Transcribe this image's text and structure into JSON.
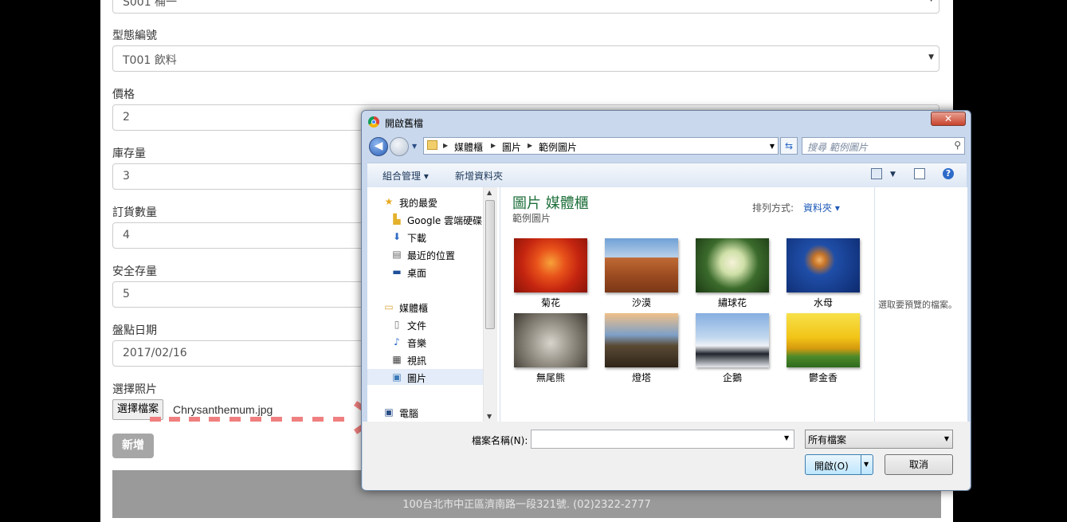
{
  "form": {
    "top_select_value": "S001 桶一",
    "type_label": "型態編號",
    "type_value": "T001 飲料",
    "price_label": "價格",
    "price_value": "2",
    "stock_label": "庫存量",
    "stock_value": "3",
    "order_label": "訂貨數量",
    "order_value": "4",
    "safety_label": "安全存量",
    "safety_value": "5",
    "date_label": "盤點日期",
    "date_value": "2017/02/16",
    "photo_label": "選擇照片",
    "file_button": "選擇檔案",
    "file_name": "Chrysanthemum.jpg",
    "add_button": "新增"
  },
  "footer": {
    "address": "100台北市中正區濟南路一段321號. (02)2322-2777"
  },
  "dialog": {
    "title": "開啟舊檔",
    "close_label": "✕",
    "breadcrumb": [
      "媒體櫃",
      "圖片",
      "範例圖片"
    ],
    "search_placeholder": "搜尋 範例圖片",
    "toolbar": {
      "organize": "組合管理 ▾",
      "new_folder": "新增資料夾"
    },
    "nav": {
      "favorites": "我的最愛",
      "google_drive": "Google 雲端硬碟",
      "downloads": "下載",
      "recent": "最近的位置",
      "desktop": "桌面",
      "libraries": "媒體櫃",
      "documents": "文件",
      "music": "音樂",
      "videos": "視訊",
      "pictures": "圖片",
      "computer": "電腦"
    },
    "library_title": "圖片 媒體櫃",
    "library_subtitle": "範例圖片",
    "sort_label": "排列方式:",
    "sort_value": "資料夾 ▾",
    "images": [
      {
        "caption": "菊花"
      },
      {
        "caption": "沙漠"
      },
      {
        "caption": "繡球花"
      },
      {
        "caption": "水母"
      },
      {
        "caption": "無尾熊"
      },
      {
        "caption": "燈塔"
      },
      {
        "caption": "企鵝"
      },
      {
        "caption": "鬱金香"
      }
    ],
    "preview_text": "選取要預覽的檔案。",
    "filename_label": "檔案名稱(N):",
    "filename_value": "",
    "filetype_value": "所有檔案",
    "open_button": "開啟(O)",
    "cancel_button": "取消"
  }
}
